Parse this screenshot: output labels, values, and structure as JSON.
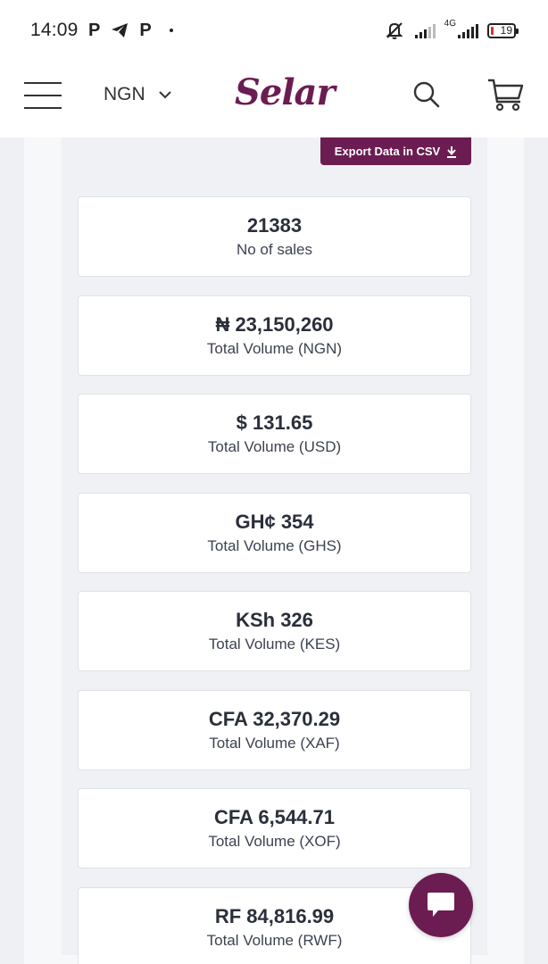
{
  "status_bar": {
    "time": "14:09",
    "left_icons": [
      "p-icon",
      "telegram-icon",
      "p-icon",
      "dot"
    ],
    "network_label": "4G",
    "battery_level": "19"
  },
  "header": {
    "currency": "NGN",
    "logo": "Selar",
    "brand_color": "#6b1d52"
  },
  "export_button": {
    "label": "Export Data in CSV"
  },
  "stats": [
    {
      "value": "21383",
      "label": "No of sales"
    },
    {
      "value": "₦ 23,150,260",
      "label": "Total Volume (NGN)"
    },
    {
      "value": "$ 131.65",
      "label": "Total Volume (USD)"
    },
    {
      "value": "GH¢ 354",
      "label": "Total Volume (GHS)"
    },
    {
      "value": "KSh 326",
      "label": "Total Volume (KES)"
    },
    {
      "value": "CFA 32,370.29",
      "label": "Total Volume (XAF)"
    },
    {
      "value": "CFA 6,544.71",
      "label": "Total Volume (XOF)"
    },
    {
      "value": "RF 84,816.99",
      "label": "Total Volume (RWF)"
    }
  ]
}
